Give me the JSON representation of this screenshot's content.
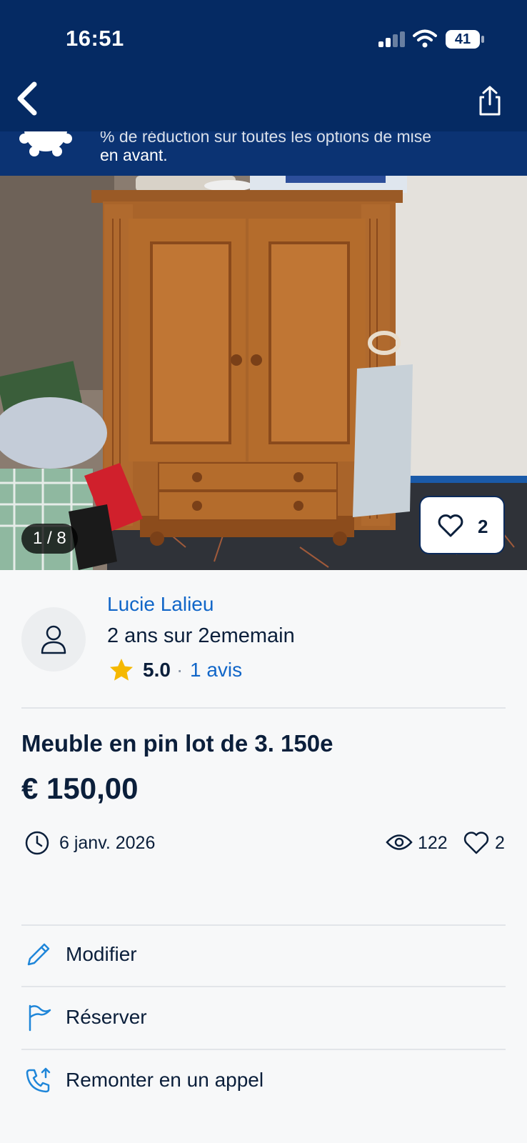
{
  "status_bar": {
    "time": "16:51",
    "battery": "41"
  },
  "promo": {
    "line1": "% de réduction sur toutes les options de mise",
    "line2": "en avant."
  },
  "photo": {
    "counter": "1 / 8",
    "likes": "2"
  },
  "seller": {
    "name": "Lucie Lalieu",
    "since": "2 ans sur 2ememain",
    "rating": "5.0",
    "separator": "·",
    "reviews": "1 avis"
  },
  "listing": {
    "title": "Meuble en pin lot de 3. 150e",
    "price": "€ 150,00",
    "date": "6 janv. 2026",
    "views": "122",
    "likes": "2"
  },
  "actions": [
    {
      "label": "Modifier",
      "icon": "pencil-icon"
    },
    {
      "label": "Réserver",
      "icon": "flag-icon"
    },
    {
      "label": "Remonter en un appel",
      "icon": "phone-up-icon"
    }
  ],
  "colors": {
    "header_bg": "#052a63",
    "promo_bg": "#0b3373",
    "link": "#1166c8",
    "text": "#0b1f3b",
    "icon_accent": "#1f86d9",
    "star": "#f5b800"
  }
}
